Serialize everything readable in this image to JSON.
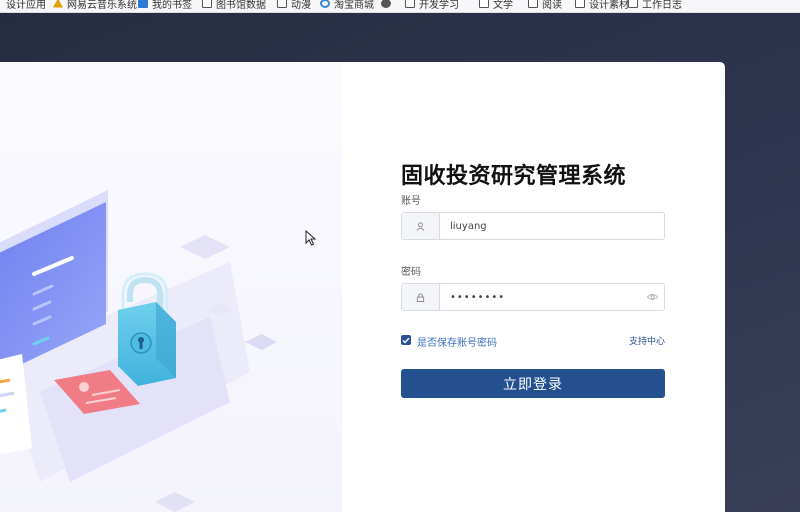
{
  "bookmarks": [
    {
      "label": "设计应用",
      "icon": "folder-icon"
    },
    {
      "label": "网易云音乐系统",
      "icon": "warning-icon"
    },
    {
      "label": "我的书签",
      "icon": "blue-square-icon"
    },
    {
      "label": "图书馆数据",
      "icon": "folder-icon"
    },
    {
      "label": "动漫",
      "icon": "folder-icon"
    },
    {
      "label": "淘宝商城",
      "icon": "browser-icon"
    },
    {
      "label": "",
      "icon": "globe-icon"
    },
    {
      "label": "开发学习",
      "icon": "folder-icon"
    },
    {
      "label": "文学",
      "icon": "folder-icon"
    },
    {
      "label": "阅读",
      "icon": "folder-icon"
    },
    {
      "label": "设计素材",
      "icon": "folder-icon"
    },
    {
      "label": "工作日志",
      "icon": "folder-icon"
    }
  ],
  "form": {
    "title": "固收投资研究管理系统",
    "account": {
      "label": "账号",
      "value": "liuyang",
      "icon": "user-icon"
    },
    "password": {
      "label": "密码",
      "value": "••••••••",
      "icon": "lock-icon",
      "toggle_icon": "eye-icon"
    },
    "remember": {
      "label": "是否保存账号密码",
      "checked": true
    },
    "support_link": "支持中心",
    "login_button": "立即登录"
  },
  "colors": {
    "background": "#2a3048",
    "primary": "#24508f",
    "link": "#3c6fbf"
  }
}
